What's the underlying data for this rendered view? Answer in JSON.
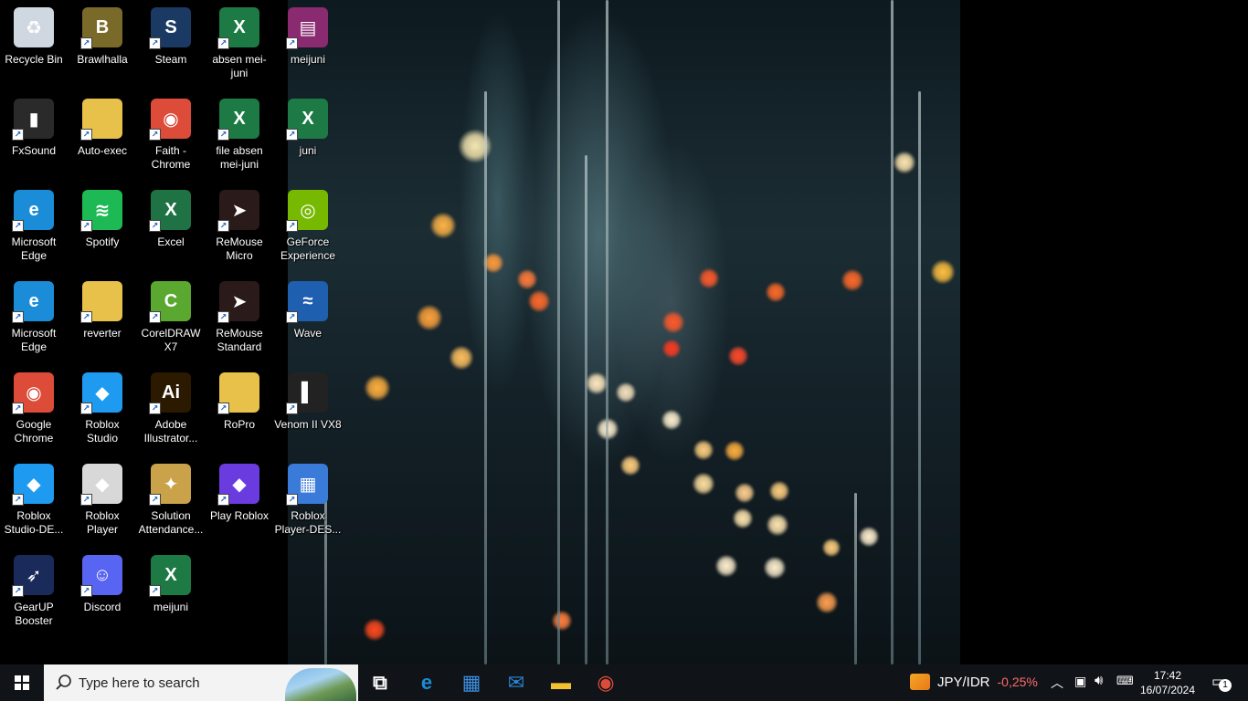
{
  "desktop": {
    "icons": [
      {
        "name": "recycle-bin",
        "label": "Recycle Bin",
        "color": "#cfd8e0",
        "glyph": "♻"
      },
      {
        "name": "brawlhalla",
        "label": "Brawlhalla",
        "color": "#7a6a2a",
        "glyph": "B"
      },
      {
        "name": "steam",
        "label": "Steam",
        "color": "#1b3a63",
        "glyph": "S"
      },
      {
        "name": "absen-mei-juni",
        "label": "absen mei-juni",
        "color": "#1d7a45",
        "glyph": "X"
      },
      {
        "name": "meijuni-rar",
        "label": "meijuni",
        "color": "#8a2a70",
        "glyph": "▤"
      },
      {
        "name": "fxsound",
        "label": "FxSound",
        "color": "#2a2a2a",
        "glyph": "▮"
      },
      {
        "name": "auto-exec",
        "label": "Auto-exec",
        "color": "#e8c14a",
        "glyph": ""
      },
      {
        "name": "faith-chrome",
        "label": "Faith - Chrome",
        "color": "#dd4b39",
        "glyph": "◉"
      },
      {
        "name": "file-absen-mei-juni",
        "label": "file absen mei-juni",
        "color": "#1d7a45",
        "glyph": "X"
      },
      {
        "name": "juni",
        "label": "juni",
        "color": "#1d7a45",
        "glyph": "X"
      },
      {
        "name": "microsoft-edge-1",
        "label": "Microsoft Edge",
        "color": "#1b8cd8",
        "glyph": "e"
      },
      {
        "name": "spotify",
        "label": "Spotify",
        "color": "#1db954",
        "glyph": "≋"
      },
      {
        "name": "excel",
        "label": "Excel",
        "color": "#1f7244",
        "glyph": "X"
      },
      {
        "name": "remouse-micro",
        "label": "ReMouse Micro",
        "color": "#2a1a1a",
        "glyph": "➤"
      },
      {
        "name": "geforce-experience",
        "label": "GeForce Experience",
        "color": "#76b900",
        "glyph": "◎"
      },
      {
        "name": "microsoft-edge-2",
        "label": "Microsoft Edge",
        "color": "#1b8cd8",
        "glyph": "e"
      },
      {
        "name": "reverter",
        "label": "reverter",
        "color": "#e8c14a",
        "glyph": ""
      },
      {
        "name": "coreldraw-x7",
        "label": "CorelDRAW X7",
        "color": "#5aa830",
        "glyph": "C"
      },
      {
        "name": "remouse-standard",
        "label": "ReMouse Standard",
        "color": "#2a1a1a",
        "glyph": "➤"
      },
      {
        "name": "wave",
        "label": "Wave",
        "color": "#1f5fb0",
        "glyph": "≈"
      },
      {
        "name": "google-chrome",
        "label": "Google Chrome",
        "color": "#dd4b39",
        "glyph": "◉"
      },
      {
        "name": "roblox-studio",
        "label": "Roblox Studio",
        "color": "#1e9bf0",
        "glyph": "◆"
      },
      {
        "name": "adobe-illustrator",
        "label": "Adobe Illustrator...",
        "color": "#2b1a00",
        "glyph": "Ai"
      },
      {
        "name": "ropro",
        "label": "RoPro",
        "color": "#e8c14a",
        "glyph": ""
      },
      {
        "name": "venom-ii-vx8",
        "label": "Venom II VX8",
        "color": "#222222",
        "glyph": "▌"
      },
      {
        "name": "roblox-studio-de",
        "label": "Roblox Studio-DE...",
        "color": "#1e9bf0",
        "glyph": "◆"
      },
      {
        "name": "roblox-player",
        "label": "Roblox Player",
        "color": "#d8d8d8",
        "glyph": "◆"
      },
      {
        "name": "solution-attendance",
        "label": "Solution Attendance...",
        "color": "#c9a24a",
        "glyph": "✦"
      },
      {
        "name": "play-roblox",
        "label": "Play Roblox",
        "color": "#6a3ce0",
        "glyph": "◆"
      },
      {
        "name": "roblox-player-des",
        "label": "Roblox Player-DES...",
        "color": "#3a7ad8",
        "glyph": "▦"
      },
      {
        "name": "gearup-booster",
        "label": "GearUP Booster",
        "color": "#1a2a5a",
        "glyph": "➶"
      },
      {
        "name": "discord",
        "label": "Discord",
        "color": "#5865f2",
        "glyph": "☺"
      },
      {
        "name": "meijuni-xlsx",
        "label": "meijuni",
        "color": "#1d7a45",
        "glyph": "X"
      }
    ]
  },
  "taskbar": {
    "search_placeholder": "Type here to search",
    "apps": [
      {
        "name": "task-view",
        "glyph": "⧉",
        "color": "#ffffff"
      },
      {
        "name": "edge",
        "glyph": "e",
        "color": "#1b8cd8"
      },
      {
        "name": "microsoft-store",
        "glyph": "▦",
        "color": "#3a8fe0"
      },
      {
        "name": "mail",
        "glyph": "✉",
        "color": "#2b88d8"
      },
      {
        "name": "file-explorer",
        "glyph": "▬",
        "color": "#f2c230"
      },
      {
        "name": "chrome",
        "glyph": "◉",
        "color": "#dd4b39"
      }
    ],
    "tray": {
      "stock_symbol": "JPY/IDR",
      "stock_change": "-0,25%",
      "stock_change_color": "#ff6b6b",
      "time": "17:42",
      "date": "16/07/2024",
      "notification_count": "1"
    }
  }
}
